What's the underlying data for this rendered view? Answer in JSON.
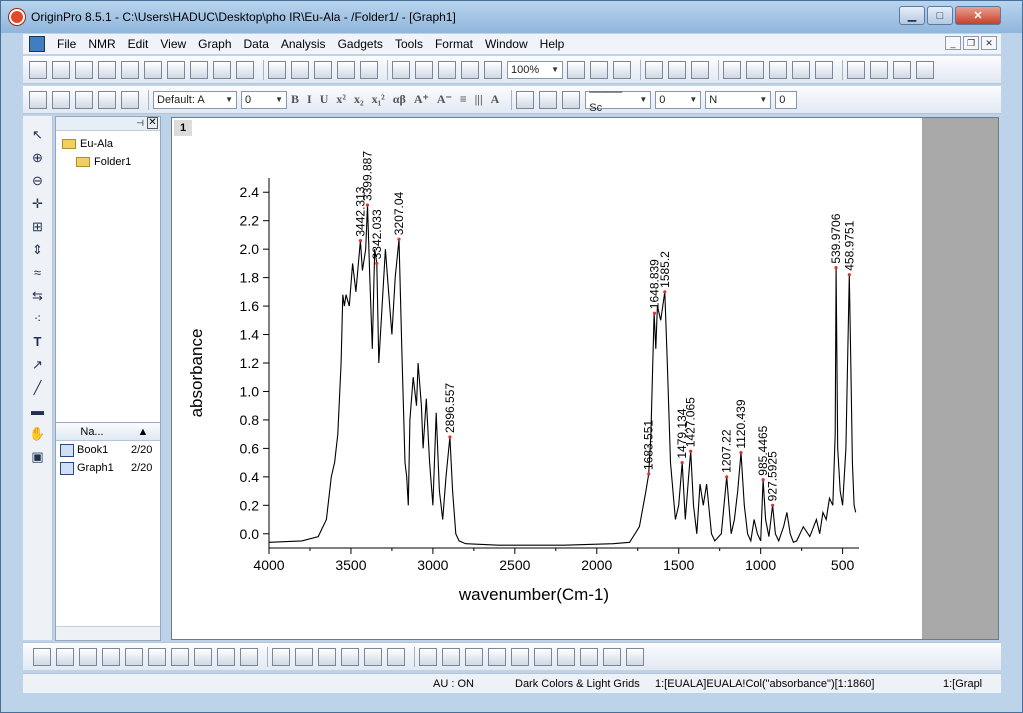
{
  "window": {
    "title": "OriginPro 8.5.1 - C:\\Users\\HADUC\\Desktop\\pho IR\\Eu-Ala - /Folder1/ - [Graph1]",
    "min": "▁",
    "max": "□",
    "close": "✕"
  },
  "menu": [
    "File",
    "NMR",
    "Edit",
    "View",
    "Graph",
    "Data",
    "Analysis",
    "Gadgets",
    "Tools",
    "Format",
    "Window",
    "Help"
  ],
  "toolbar1": {
    "zoom": "100%"
  },
  "toolbar2": {
    "font": "Default: A",
    "font_size": "0",
    "line_style": "——— Sc",
    "line_width": "0",
    "fill": "N",
    "last": "0"
  },
  "explorer": {
    "root": "Eu-Ala",
    "folder": "Folder1",
    "name_header": "Na...",
    "items": [
      {
        "name": "Book1",
        "date": "2/20"
      },
      {
        "name": "Graph1",
        "date": "2/20"
      }
    ]
  },
  "graph": {
    "tab": "1"
  },
  "status": {
    "au": "AU : ON",
    "theme": "Dark Colors & Light Grids",
    "col": "1:[EUALA]EUALA!Col(\"absorbance\")[1:1860]",
    "win": "1:[Grapl"
  },
  "chart_data": {
    "type": "line",
    "xlabel": "wavenumber(Cm-1)",
    "ylabel": "absorbance",
    "xlim": [
      4000,
      400
    ],
    "ylim": [
      -0.1,
      2.5
    ],
    "xticks": [
      4000,
      3500,
      3000,
      2500,
      2000,
      1500,
      1000,
      500
    ],
    "yticks": [
      0.0,
      0.2,
      0.4,
      0.6,
      0.8,
      1.0,
      1.2,
      1.4,
      1.6,
      1.8,
      2.0,
      2.2,
      2.4
    ],
    "points": [
      [
        4000,
        -0.06
      ],
      [
        3800,
        -0.05
      ],
      [
        3700,
        -0.02
      ],
      [
        3650,
        0.1
      ],
      [
        3620,
        0.4
      ],
      [
        3600,
        0.5
      ],
      [
        3580,
        0.7
      ],
      [
        3560,
        1.2
      ],
      [
        3550,
        1.68
      ],
      [
        3540,
        1.6
      ],
      [
        3530,
        1.68
      ],
      [
        3510,
        1.6
      ],
      [
        3490,
        1.9
      ],
      [
        3470,
        1.7
      ],
      [
        3442,
        2.06
      ],
      [
        3430,
        1.85
      ],
      [
        3410,
        2.0
      ],
      [
        3399,
        2.31
      ],
      [
        3385,
        1.8
      ],
      [
        3370,
        1.3
      ],
      [
        3355,
        2.0
      ],
      [
        3342,
        1.9
      ],
      [
        3330,
        1.2
      ],
      [
        3310,
        1.6
      ],
      [
        3290,
        2.0
      ],
      [
        3270,
        1.7
      ],
      [
        3250,
        1.4
      ],
      [
        3230,
        1.8
      ],
      [
        3207,
        2.07
      ],
      [
        3190,
        1.3
      ],
      [
        3170,
        0.5
      ],
      [
        3160,
        0.4
      ],
      [
        3150,
        0.2
      ],
      [
        3140,
        0.8
      ],
      [
        3120,
        1.1
      ],
      [
        3100,
        0.9
      ],
      [
        3090,
        1.2
      ],
      [
        3070,
        0.9
      ],
      [
        3060,
        0.6
      ],
      [
        3040,
        0.95
      ],
      [
        3020,
        0.5
      ],
      [
        3000,
        0.2
      ],
      [
        2980,
        0.85
      ],
      [
        2960,
        0.3
      ],
      [
        2940,
        0.1
      ],
      [
        2920,
        0.4
      ],
      [
        2896,
        0.68
      ],
      [
        2880,
        0.3
      ],
      [
        2860,
        0.0
      ],
      [
        2840,
        -0.05
      ],
      [
        2800,
        -0.07
      ],
      [
        2600,
        -0.08
      ],
      [
        2200,
        -0.08
      ],
      [
        1900,
        -0.07
      ],
      [
        1800,
        -0.06
      ],
      [
        1740,
        0.05
      ],
      [
        1700,
        0.3
      ],
      [
        1683,
        0.42
      ],
      [
        1670,
        0.7
      ],
      [
        1650,
        1.55
      ],
      [
        1640,
        1.3
      ],
      [
        1630,
        1.6
      ],
      [
        1610,
        1.5
      ],
      [
        1585,
        1.7
      ],
      [
        1570,
        1.2
      ],
      [
        1550,
        0.5
      ],
      [
        1520,
        0.1
      ],
      [
        1500,
        0.2
      ],
      [
        1479,
        0.5
      ],
      [
        1460,
        0.1
      ],
      [
        1440,
        0.4
      ],
      [
        1427,
        0.58
      ],
      [
        1410,
        0.2
      ],
      [
        1390,
        0.0
      ],
      [
        1370,
        0.35
      ],
      [
        1350,
        0.2
      ],
      [
        1330,
        0.35
      ],
      [
        1300,
        0.0
      ],
      [
        1280,
        -0.05
      ],
      [
        1240,
        0.0
      ],
      [
        1207,
        0.4
      ],
      [
        1180,
        0.0
      ],
      [
        1160,
        0.1
      ],
      [
        1140,
        0.3
      ],
      [
        1120,
        0.57
      ],
      [
        1100,
        0.2
      ],
      [
        1080,
        0.0
      ],
      [
        1060,
        -0.05
      ],
      [
        1040,
        0.1
      ],
      [
        1020,
        0.0
      ],
      [
        1000,
        -0.05
      ],
      [
        985,
        0.38
      ],
      [
        970,
        0.1
      ],
      [
        950,
        -0.02
      ],
      [
        927,
        0.2
      ],
      [
        910,
        0.0
      ],
      [
        890,
        -0.05
      ],
      [
        860,
        0.05
      ],
      [
        840,
        0.15
      ],
      [
        820,
        0.0
      ],
      [
        800,
        -0.06
      ],
      [
        780,
        -0.05
      ],
      [
        740,
        0.05
      ],
      [
        700,
        -0.02
      ],
      [
        660,
        0.1
      ],
      [
        640,
        0.0
      ],
      [
        620,
        0.15
      ],
      [
        600,
        0.1
      ],
      [
        580,
        0.25
      ],
      [
        560,
        0.2
      ],
      [
        545,
        0.7
      ],
      [
        540,
        1.87
      ],
      [
        530,
        0.6
      ],
      [
        515,
        0.3
      ],
      [
        500,
        0.2
      ],
      [
        480,
        0.6
      ],
      [
        459,
        1.82
      ],
      [
        450,
        1.2
      ],
      [
        440,
        0.5
      ],
      [
        430,
        0.2
      ],
      [
        420,
        0.15
      ]
    ],
    "annotations": [
      {
        "x": 3442,
        "y": 2.06,
        "label": "3442.313"
      },
      {
        "x": 3399,
        "y": 2.31,
        "label": "3399.887"
      },
      {
        "x": 3342,
        "y": 1.9,
        "label": "3342.033"
      },
      {
        "x": 3207,
        "y": 2.07,
        "label": "3207.04"
      },
      {
        "x": 2896,
        "y": 0.68,
        "label": "2896.557"
      },
      {
        "x": 1683,
        "y": 0.42,
        "label": "1683.551"
      },
      {
        "x": 1648,
        "y": 1.55,
        "label": "1648.839"
      },
      {
        "x": 1585,
        "y": 1.7,
        "label": "1585.2"
      },
      {
        "x": 1479,
        "y": 0.5,
        "label": "1479.134"
      },
      {
        "x": 1427,
        "y": 0.58,
        "label": "1427.065"
      },
      {
        "x": 1207,
        "y": 0.4,
        "label": "1207.22"
      },
      {
        "x": 1120,
        "y": 0.57,
        "label": "1120.439"
      },
      {
        "x": 985,
        "y": 0.38,
        "label": "985.4465"
      },
      {
        "x": 927,
        "y": 0.2,
        "label": "927.5925"
      },
      {
        "x": 540,
        "y": 1.87,
        "label": "539.9706"
      },
      {
        "x": 459,
        "y": 1.82,
        "label": "458.9751"
      }
    ]
  }
}
